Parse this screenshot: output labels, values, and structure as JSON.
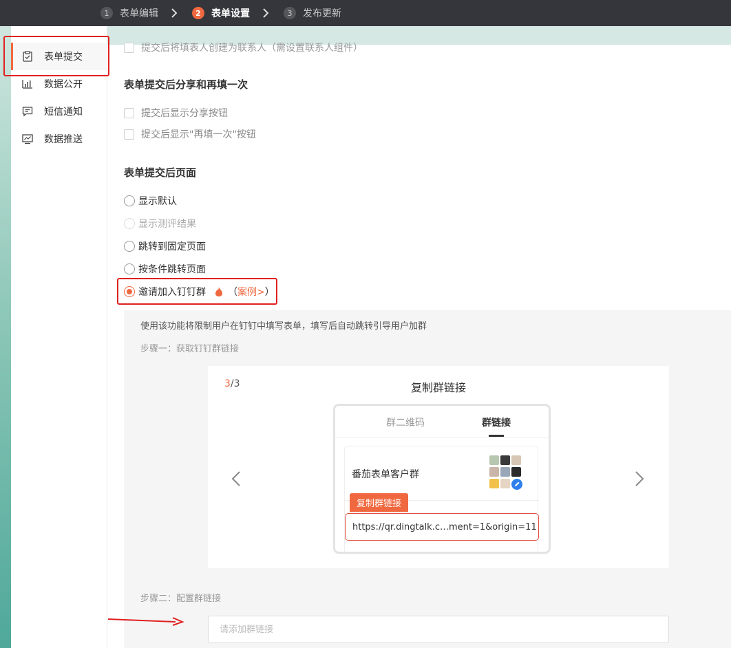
{
  "steps": [
    {
      "num": "1",
      "label": "表单编辑"
    },
    {
      "num": "2",
      "label": "表单设置"
    },
    {
      "num": "3",
      "label": "发布更新"
    }
  ],
  "sidebar": {
    "items": [
      {
        "label": "表单提交",
        "icon": "form-submit-icon"
      },
      {
        "label": "数据公开",
        "icon": "bar-chart-icon"
      },
      {
        "label": "短信通知",
        "icon": "message-icon"
      },
      {
        "label": "数据推送",
        "icon": "data-push-icon"
      }
    ]
  },
  "main": {
    "cut_text": "提交后将填表人创建为联系人（需设置联系人组件）",
    "share_title": "表单提交后分享和再填一次",
    "share_options": [
      "提交后显示分享按钮",
      "提交后显示\"再填一次\"按钮"
    ],
    "page_title": "表单提交后页面",
    "page_options": [
      {
        "label": "显示默认",
        "state": "unchecked"
      },
      {
        "label": "显示测评结果",
        "state": "disabled"
      },
      {
        "label": "跳转到固定页面",
        "state": "unchecked"
      },
      {
        "label": "按条件跳转页面",
        "state": "unchecked"
      },
      {
        "label": "邀请加入钉钉群",
        "state": "checked"
      }
    ],
    "example_open": "（",
    "example_link": "案例>",
    "example_close": "）",
    "panel": {
      "description": "使用该功能将限制用户在钉钉中填写表单，填写后自动跳转引导用户加群",
      "step1": "步骤一：获取钉钉群链接",
      "card": {
        "count_current": "3",
        "count_total": "/3",
        "title": "复制群链接",
        "tab_qr": "群二维码",
        "tab_link": "群链接",
        "group_name": "番茄表单客户群",
        "copy_label": "复制群链接",
        "link_value": "https://qr.dingtalk.c…ment=1&origin=11"
      },
      "step2": "步骤二：配置群链接",
      "input_placeholder": "请添加群链接"
    }
  },
  "colors": {
    "accent": "#f0683f",
    "topbar": "#35363b",
    "annotation": "#e02020"
  }
}
